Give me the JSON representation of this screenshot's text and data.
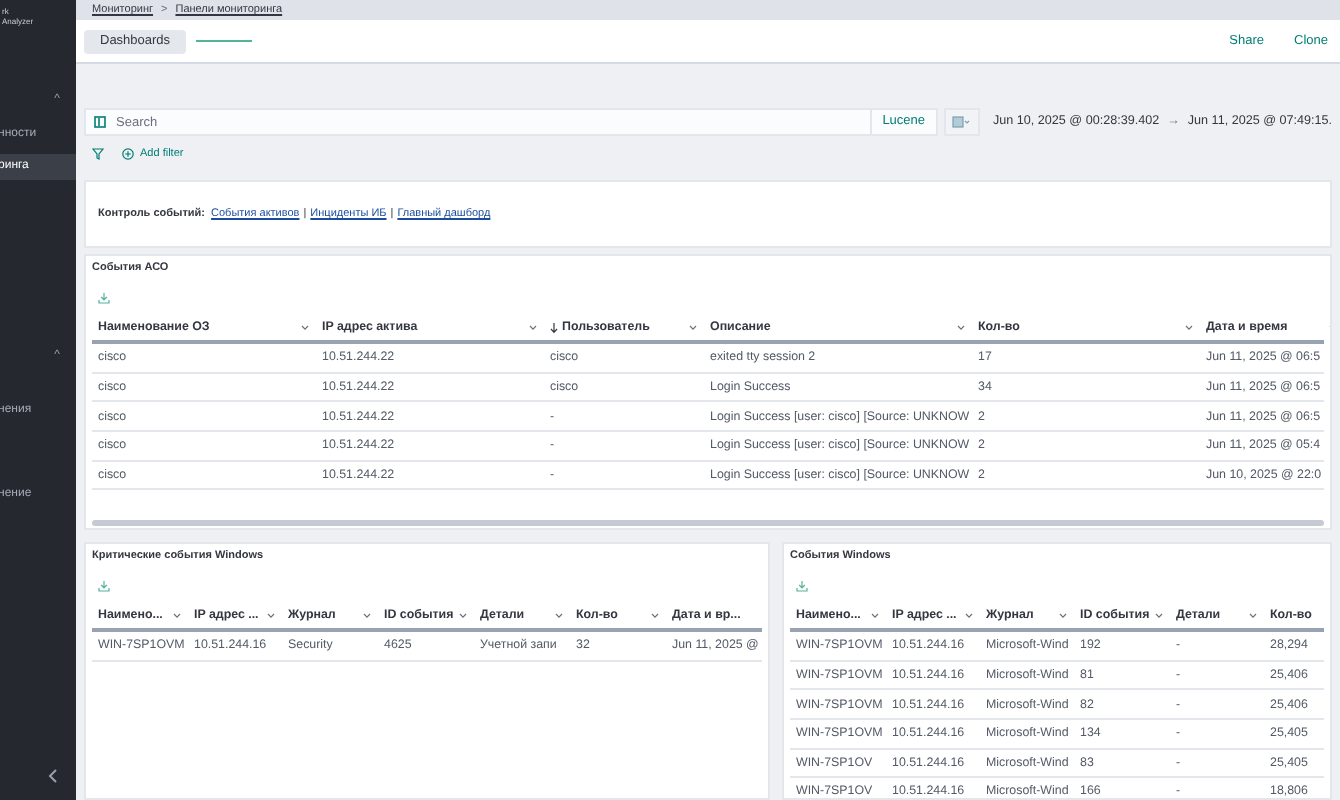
{
  "sidebar": {
    "logo_lines": [
      "rk",
      "Analyzer"
    ],
    "items": [
      {
        "kind": "chevron",
        "label": "^"
      },
      {
        "kind": "item",
        "label": "нности",
        "selected": false
      },
      {
        "kind": "item",
        "label": "ринга",
        "selected": true
      },
      {
        "kind": "chevron",
        "label": "^"
      },
      {
        "kind": "item",
        "label": "нения",
        "selected": false
      },
      {
        "kind": "item",
        "label": "нение",
        "selected": false
      }
    ]
  },
  "breadcrumbs": {
    "separator": ">",
    "items": [
      "Мониторинг",
      "Панели мониторинга"
    ]
  },
  "header": {
    "tab": "Dashboards",
    "actions": [
      "Share",
      "Clone"
    ]
  },
  "query_bar": {
    "placeholder": "Search",
    "language": "Lucene",
    "date_start": "Jun 10, 2025 @ 00:28:39.402",
    "arrow": "→",
    "date_end": "Jun 11, 2025 @ 07:49:15."
  },
  "filter_bar": {
    "add_filter": "Add filter"
  },
  "links_panel": {
    "label": "Контроль событий:",
    "separators": [
      "|",
      "|"
    ],
    "links": [
      "События активов",
      "Инциденты ИБ",
      "Главный дашборд"
    ]
  },
  "aco_table": {
    "title": "События АСО",
    "columns": [
      {
        "label": "Наименование ОЗ",
        "sorted": false
      },
      {
        "label": "IP адрес актива",
        "sorted": false
      },
      {
        "label": "Пользователь",
        "sorted": true
      },
      {
        "label": "Описание",
        "sorted": false
      },
      {
        "label": "Кол-во",
        "sorted": false
      },
      {
        "label": "Дата и время",
        "sorted": false
      }
    ],
    "rows": [
      [
        "cisco",
        "10.51.244.22",
        "cisco",
        "exited tty session 2",
        "17",
        "Jun 11, 2025 @ 06:5"
      ],
      [
        "cisco",
        "10.51.244.22",
        "cisco",
        "Login Success",
        "34",
        "Jun 11, 2025 @ 06:5"
      ],
      [
        "cisco",
        "10.51.244.22",
        "-",
        "Login Success [user: cisco] [Source: UNKNOW",
        "2",
        "Jun 11, 2025 @ 06:5"
      ],
      [
        "cisco",
        "10.51.244.22",
        "-",
        "Login Success [user: cisco] [Source: UNKNOW",
        "2",
        "Jun 11, 2025 @ 05:4"
      ],
      [
        "cisco",
        "10.51.244.22",
        "-",
        "Login Success [user: cisco] [Source: UNKNOW",
        "2",
        "Jun 10, 2025 @ 22:0"
      ]
    ]
  },
  "critical_table": {
    "title": "Критические события Windows",
    "columns": [
      "Наимено...",
      "IP адрес ...",
      "Журнал",
      "ID события",
      "Детали",
      "Кол-во",
      "Дата и вр..."
    ],
    "rows": [
      [
        "WIN-7SP1OVM",
        "10.51.244.16",
        "Security",
        "4625",
        "Учетной запи",
        "32",
        "Jun 11, 2025 @"
      ]
    ]
  },
  "windows_table": {
    "title": "События Windows",
    "columns": [
      "Наимено...",
      "IP адрес ...",
      "Журнал",
      "ID события",
      "Детали",
      "Кол-во"
    ],
    "rows": [
      [
        "WIN-7SP1OVM",
        "10.51.244.16",
        "Microsoft-Wind",
        "192",
        "-",
        "28,294"
      ],
      [
        "WIN-7SP1OVM",
        "10.51.244.16",
        "Microsoft-Wind",
        "81",
        "-",
        "25,406"
      ],
      [
        "WIN-7SP1OVM",
        "10.51.244.16",
        "Microsoft-Wind",
        "82",
        "-",
        "25,406"
      ],
      [
        "WIN-7SP1OVM",
        "10.51.244.16",
        "Microsoft-Wind",
        "134",
        "-",
        "25,405"
      ],
      [
        "WIN-7SP1OV",
        "10.51.244.16",
        "Microsoft-Wind",
        "83",
        "-",
        "25,405"
      ],
      [
        "WIN-7SP1OV",
        "10.51.244.16",
        "Microsoft-Wind",
        "166",
        "-",
        "18,806"
      ]
    ]
  }
}
